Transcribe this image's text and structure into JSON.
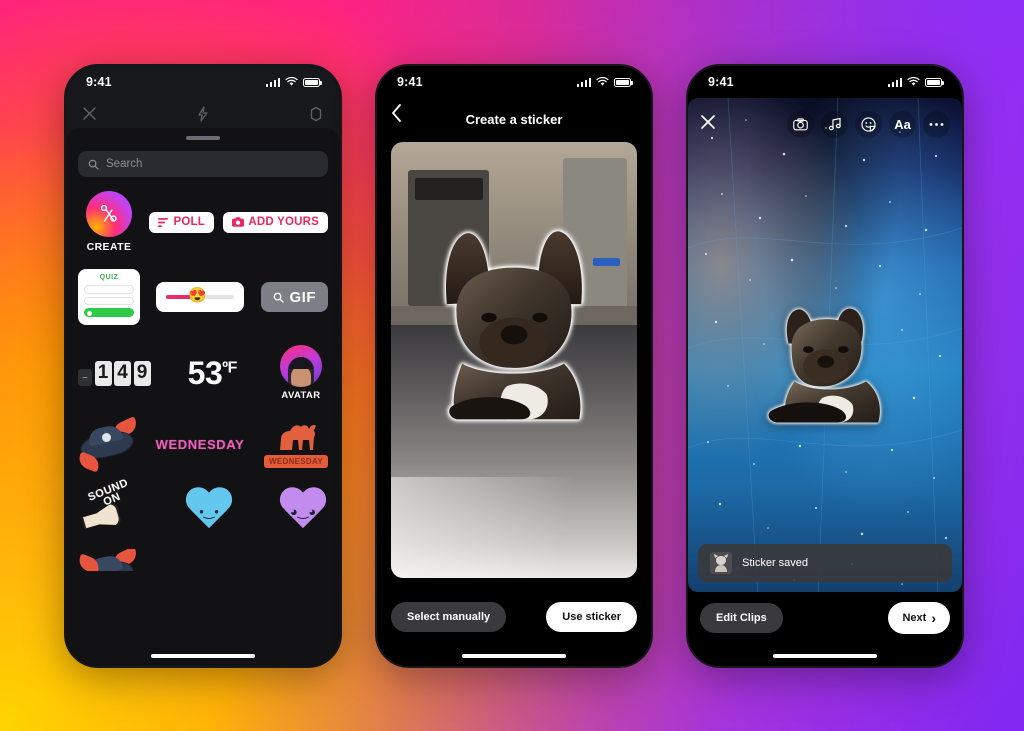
{
  "background": {
    "gradient_colors": [
      "#ff1493",
      "#ff2d6f",
      "#ff7a00",
      "#ffc400",
      "#7b2ff7",
      "#ff1f6d"
    ]
  },
  "status_bar": {
    "time": "9:41",
    "signal_icon": "signal-bars-icon",
    "wifi_icon": "wifi-icon",
    "battery_icon": "battery-icon"
  },
  "phone1": {
    "name": "sticker-tray-screen",
    "topbar": {
      "close_icon": "close-icon",
      "flash_icon": "flash-icon",
      "settings_icon": "settings-icon"
    },
    "grabber": "drag-handle",
    "search": {
      "placeholder": "Search",
      "icon": "search-icon"
    },
    "stickers": {
      "create": {
        "label": "CREATE",
        "icon": "scissors-icon"
      },
      "poll": {
        "label": "POLL",
        "icon": "poll-bars-icon"
      },
      "add_yours": {
        "label": "ADD YOURS",
        "icon": "camera-icon"
      },
      "quiz": {
        "label": "QUIZ"
      },
      "slider": {
        "emoji": "😍"
      },
      "gif": {
        "label": "GIF",
        "icon": "search-icon"
      },
      "countdown": {
        "digits": [
          "1",
          "4",
          "9"
        ],
        "dim_digit": "–"
      },
      "temperature": {
        "value": "53",
        "unit": "ºF"
      },
      "avatar": {
        "label": "AVATAR"
      },
      "pirate_hat": {
        "name": "pirate-hat-sticker"
      },
      "wednesday_text": {
        "label": "WEDNESDAY"
      },
      "camel": {
        "label": "WEDNESDAY"
      },
      "sound_on": {
        "line1": "SOUND",
        "line2": "ON"
      },
      "heart_blue": {
        "face": "•‿•"
      },
      "heart_purple": {
        "face": "◕‿◕"
      }
    }
  },
  "phone2": {
    "name": "create-a-sticker-screen",
    "back_icon": "chevron-left-icon",
    "title": "Create a sticker",
    "photo_alt": "french-bulldog-cutout-preview",
    "select_manually_label": "Select manually",
    "use_sticker_label": "Use sticker"
  },
  "phone3": {
    "name": "story-editor-screen",
    "toolbar": {
      "close_icon": "close-icon",
      "camera_icon": "camera-icon",
      "music_icon": "music-note-icon",
      "sticker_icon": "sticker-smiley-icon",
      "text_label": "Aa",
      "more_icon": "more-options-icon"
    },
    "placed_sticker": "french-bulldog-sticker",
    "toast": {
      "text": "Sticker saved",
      "thumb": "sticker-thumbnail"
    },
    "edit_clips_label": "Edit Clips",
    "next_label": "Next",
    "next_chevron": "›"
  }
}
